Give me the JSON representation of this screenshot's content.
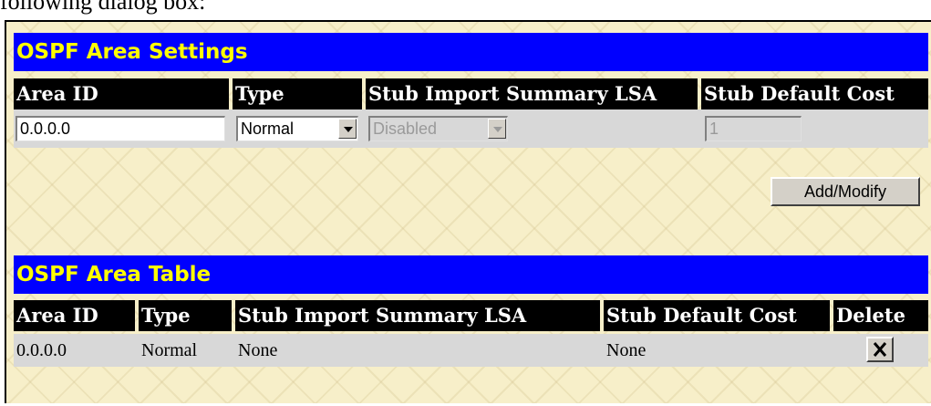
{
  "doc_text": "following dialog box:",
  "settings": {
    "title": "OSPF Area Settings",
    "columns": [
      "Area ID",
      "Type",
      "Stub Import Summary LSA",
      "Stub Default Cost"
    ],
    "area_id_value": "0.0.0.0",
    "type_selected": "Normal",
    "stub_import_selected": "Disabled",
    "stub_default_cost_value": "1",
    "add_modify_label": "Add/Modify"
  },
  "table": {
    "title": "OSPF Area Table",
    "columns": [
      "Area ID",
      "Type",
      "Stub Import Summary LSA",
      "Stub Default Cost",
      "Delete"
    ],
    "rows": [
      {
        "area_id": "0.0.0.0",
        "type": "Normal",
        "stub_import": "None",
        "stub_default_cost": "None"
      }
    ]
  },
  "colors": {
    "title_bar": "#0000ff",
    "title_text": "#ffff00",
    "header_bg": "#000000",
    "header_text": "#ffffff",
    "row_bg": "#d8d8d8",
    "panel_bg": "#f7efc9"
  },
  "icons": {
    "delete": "close-x-icon",
    "dropdown": "chevron-down-icon"
  }
}
